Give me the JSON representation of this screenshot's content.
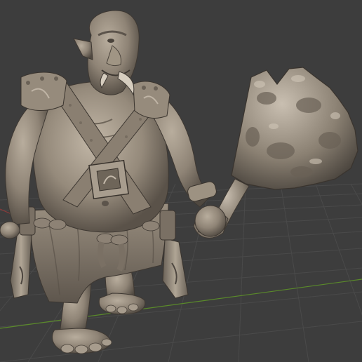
{
  "viewport": {
    "background": "#3d3d3d",
    "grid_color": "#4a4a4a",
    "x_axis_color": "#8e3a3a",
    "y_axis_color": "#5a8a2a",
    "sculpt_color": "#8f8476",
    "sculpt_highlight": "#b3a898",
    "sculpt_shadow": "#5c544b"
  },
  "scene": {
    "subject": "ogre-sculpt",
    "prop": "spiked-club"
  }
}
